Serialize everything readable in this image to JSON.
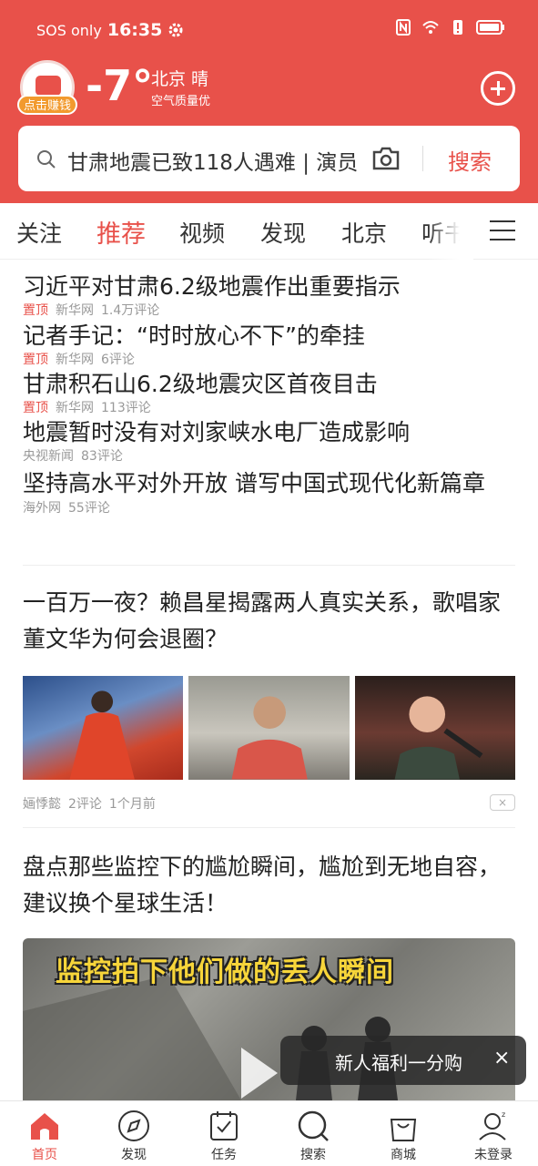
{
  "status_bar": {
    "carrier": "SOS only",
    "time": "16:35",
    "battery_icon": "battery-icon"
  },
  "header": {
    "earn_badge": "点击赚钱",
    "temperature": "-7°",
    "city_weather": "北京 晴",
    "air_quality": "空气质量优",
    "add_icon": "plus-circle-icon"
  },
  "search": {
    "query": "甘肃地震已致118人遇难 | 演员",
    "button": "搜索"
  },
  "tabs": {
    "items": [
      "关注",
      "推荐",
      "视频",
      "发现",
      "北京",
      "听书"
    ],
    "active_index": 1
  },
  "headlines": [
    {
      "title": "习近平对甘肃6.2级地震作出重要指示",
      "pin": "置顶",
      "source": "新华网",
      "comments": "1.4万评论"
    },
    {
      "title": "记者手记：“时时放心不下”的牵挂",
      "pin": "置顶",
      "source": "新华网",
      "comments": "6评论"
    },
    {
      "title": "甘肃积石山6.2级地震灾区首夜目击",
      "pin": "置顶",
      "source": "新华网",
      "comments": "113评论"
    },
    {
      "title": "地震暂时没有对刘家峡水电厂造成影响",
      "pin": "",
      "source": "央视新闻",
      "comments": "83评论"
    },
    {
      "title": "坚持高水平对外开放 谱写中国式现代化新篇章",
      "pin": "",
      "source": "海外网",
      "comments": "55评论"
    }
  ],
  "article1": {
    "title": "一百万一夜？赖昌星揭露两人真实关系，歌唱家董文华为何会退圈？",
    "source": "婳悸懿",
    "comments": "2评论",
    "time": "1个月前",
    "dismiss": "×"
  },
  "article2": {
    "title": "盘点那些监控下的尴尬瞬间，尴尬到无地自容，建议换个星球生活！",
    "video_caption": "监控拍下他们做的丢人瞬间"
  },
  "toast": {
    "text": "新人福利一分购",
    "close": "×"
  },
  "bottom_nav": {
    "items": [
      {
        "label": "首页",
        "icon": "home-icon"
      },
      {
        "label": "发现",
        "icon": "compass-icon"
      },
      {
        "label": "任务",
        "icon": "task-icon"
      },
      {
        "label": "搜索",
        "icon": "search-icon"
      },
      {
        "label": "商城",
        "icon": "shopping-bag-icon"
      },
      {
        "label": "未登录",
        "icon": "user-icon"
      }
    ],
    "active_index": 0
  },
  "colors": {
    "brand_red": "#e8514a",
    "badge_orange": "#f29a2e",
    "caption_yellow": "#f7d53a"
  }
}
